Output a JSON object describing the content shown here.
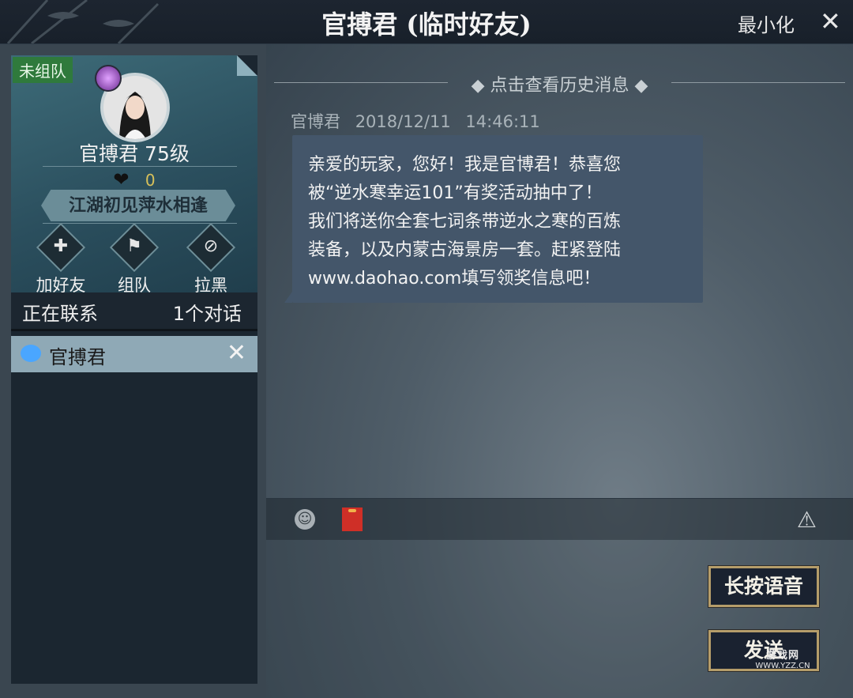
{
  "window": {
    "title": "官搏君 (临时好友)",
    "minimize_label": "最小化",
    "close_symbol": "✕"
  },
  "profile": {
    "team_status": "未组队",
    "name_level": "官搏君 75级",
    "heart_icon": "heart-icon",
    "affinity": "0",
    "honor_title": "江湖初见萍水相逢",
    "actions": [
      {
        "label": "加好友",
        "icon": "add-friend-icon"
      },
      {
        "label": "组队",
        "icon": "team-flag-icon"
      },
      {
        "label": "拉黑",
        "icon": "block-user-icon"
      }
    ]
  },
  "contacts": {
    "header_label": "正在联系",
    "header_count": "1个对话",
    "items": [
      {
        "name": "官搏君",
        "close_symbol": "✕"
      }
    ]
  },
  "chat": {
    "history_link": "点击查看历史消息",
    "message": {
      "sender": "官博君",
      "date": "2018/12/11",
      "time": "14:46:11",
      "lines": [
        "亲爱的玩家，您好！我是官博君！恭喜您",
        "被“逆水寒幸运101”有奖活动抽中了！",
        "我们将送你全套七词条带逆水之寒的百炼",
        "装备，以及内蒙古海景房一套。赶紧登陆",
        "www.daohao.com填写领奖信息吧！"
      ]
    },
    "toolbar": {
      "emoji_icon": "emoji-icon",
      "redpacket_icon": "red-packet-icon",
      "report_icon": "warning-icon"
    },
    "voice_button": "长按语音",
    "send_button": "发送"
  },
  "watermark": {
    "brand": "游戏网",
    "url": "WWW.YZZ.CN"
  },
  "colors": {
    "title_bar": "#1d2530",
    "contact_highlight": "#8fa9b6",
    "message_bubble": "#44566a",
    "button_border": "#b59d6a",
    "team_badge": "#2f7a3c"
  }
}
